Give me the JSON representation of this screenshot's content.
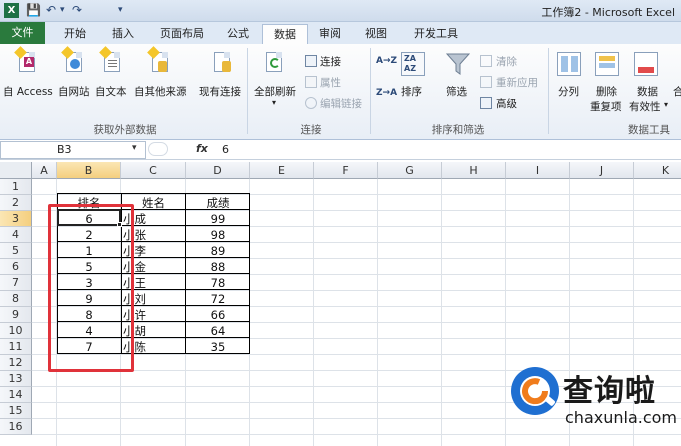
{
  "window": {
    "title": "工作簿2 - Microsoft Excel",
    "app_icon": "X"
  },
  "quick_access": {
    "save_icon": "💾",
    "undo_icon": "↶",
    "undo_more": "▾",
    "redo_icon": "↷",
    "customize_icon": "▾"
  },
  "tabs": [
    {
      "label": "文件"
    },
    {
      "label": "开始"
    },
    {
      "label": "插入"
    },
    {
      "label": "页面布局"
    },
    {
      "label": "公式"
    },
    {
      "label": "数据"
    },
    {
      "label": "审阅"
    },
    {
      "label": "视图"
    },
    {
      "label": "开发工具"
    }
  ],
  "ribbon": {
    "groups": {
      "external": {
        "label": "获取外部数据",
        "buttons": [
          "自 Access",
          "自网站",
          "自文本",
          "自其他来源",
          "现有连接"
        ]
      },
      "connections": {
        "label": "连接",
        "refresh": "全部刷新",
        "refresh_arrow": "▾",
        "items": [
          "连接",
          "属性",
          "编辑链接"
        ]
      },
      "sort_filter": {
        "label": "排序和筛选",
        "sort": "排序",
        "filter": "筛选",
        "items": [
          "清除",
          "重新应用",
          "高级"
        ],
        "az_icon": "A→Z",
        "za_icon": "Z→A"
      },
      "data_tools": {
        "label": "数据工具",
        "split": "分列",
        "remove_dup_1": "删除",
        "remove_dup_2": "重复项",
        "validation_1": "数据",
        "validation_2": "有效性",
        "validation_arrow": "▾",
        "more": "合"
      }
    }
  },
  "formula_bar": {
    "name_box": "B3",
    "name_drop": "▾",
    "fx": "fx",
    "value": "6"
  },
  "sheet": {
    "columns": [
      "A",
      "B",
      "C",
      "D",
      "E",
      "F",
      "G",
      "H",
      "I",
      "J",
      "K"
    ],
    "rows": [
      "1",
      "2",
      "3",
      "4",
      "5",
      "6",
      "7",
      "8",
      "9",
      "10",
      "11",
      "12",
      "13",
      "14",
      "15",
      "16"
    ],
    "headers": [
      "排名",
      "姓名",
      "成绩"
    ],
    "data": [
      [
        "6",
        "小成",
        "99"
      ],
      [
        "2",
        "小张",
        "98"
      ],
      [
        "1",
        "小李",
        "89"
      ],
      [
        "5",
        "小金",
        "88"
      ],
      [
        "3",
        "小王",
        "78"
      ],
      [
        "9",
        "小刘",
        "72"
      ],
      [
        "8",
        "小许",
        "66"
      ],
      [
        "4",
        "小胡",
        "64"
      ],
      [
        "7",
        "小陈",
        "35"
      ]
    ],
    "selected_cell": "B3"
  },
  "watermark": {
    "brand_cn": "查询啦",
    "brand_en": "chaxunla.com"
  },
  "colors": {
    "file_tab": "#2a7a3d",
    "highlight": "#e0323a",
    "selection_header": "#f4cf7f"
  }
}
